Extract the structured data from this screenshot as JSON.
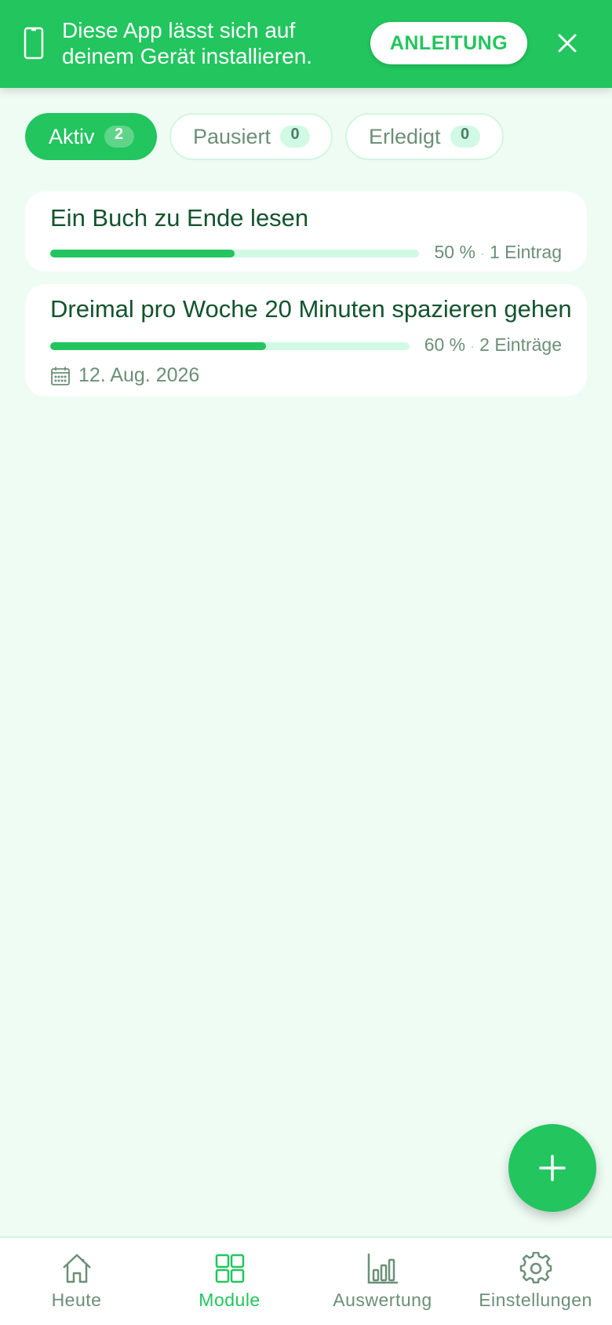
{
  "banner": {
    "message": "Diese App lässt sich auf deinem Gerät installieren.",
    "button_label": "ANLEITUNG",
    "icon": "phone-icon",
    "close_icon": "close-icon"
  },
  "tabs": [
    {
      "label": "Aktiv",
      "count": "2",
      "active": true
    },
    {
      "label": "Pausiert",
      "count": "0",
      "active": false
    },
    {
      "label": "Erledigt",
      "count": "0",
      "active": false
    }
  ],
  "goals": [
    {
      "title": "Ein Buch zu Ende lesen",
      "progress_percent": 50,
      "progress_label": "50 %",
      "entries": "1 Eintrag",
      "date": ""
    },
    {
      "title": "Dreimal pro Woche 20 Minuten spazieren gehen",
      "progress_percent": 60,
      "progress_label": "60 %",
      "entries": "2 Einträge",
      "date": "12. Aug. 2026"
    }
  ],
  "fab": {
    "icon": "plus-icon"
  },
  "nav": [
    {
      "label": "Heute",
      "icon": "home-icon",
      "active": false
    },
    {
      "label": "Module",
      "icon": "grid-icon",
      "active": true
    },
    {
      "label": "Auswertung",
      "icon": "bar-chart-icon",
      "active": false
    },
    {
      "label": "Einstellungen",
      "icon": "gear-icon",
      "active": false
    }
  ],
  "colors": {
    "accent": "#22c55e",
    "background": "#effcf4",
    "text_dark": "#14532d",
    "text_muted": "#6b8f77",
    "track": "#d1fae5"
  }
}
